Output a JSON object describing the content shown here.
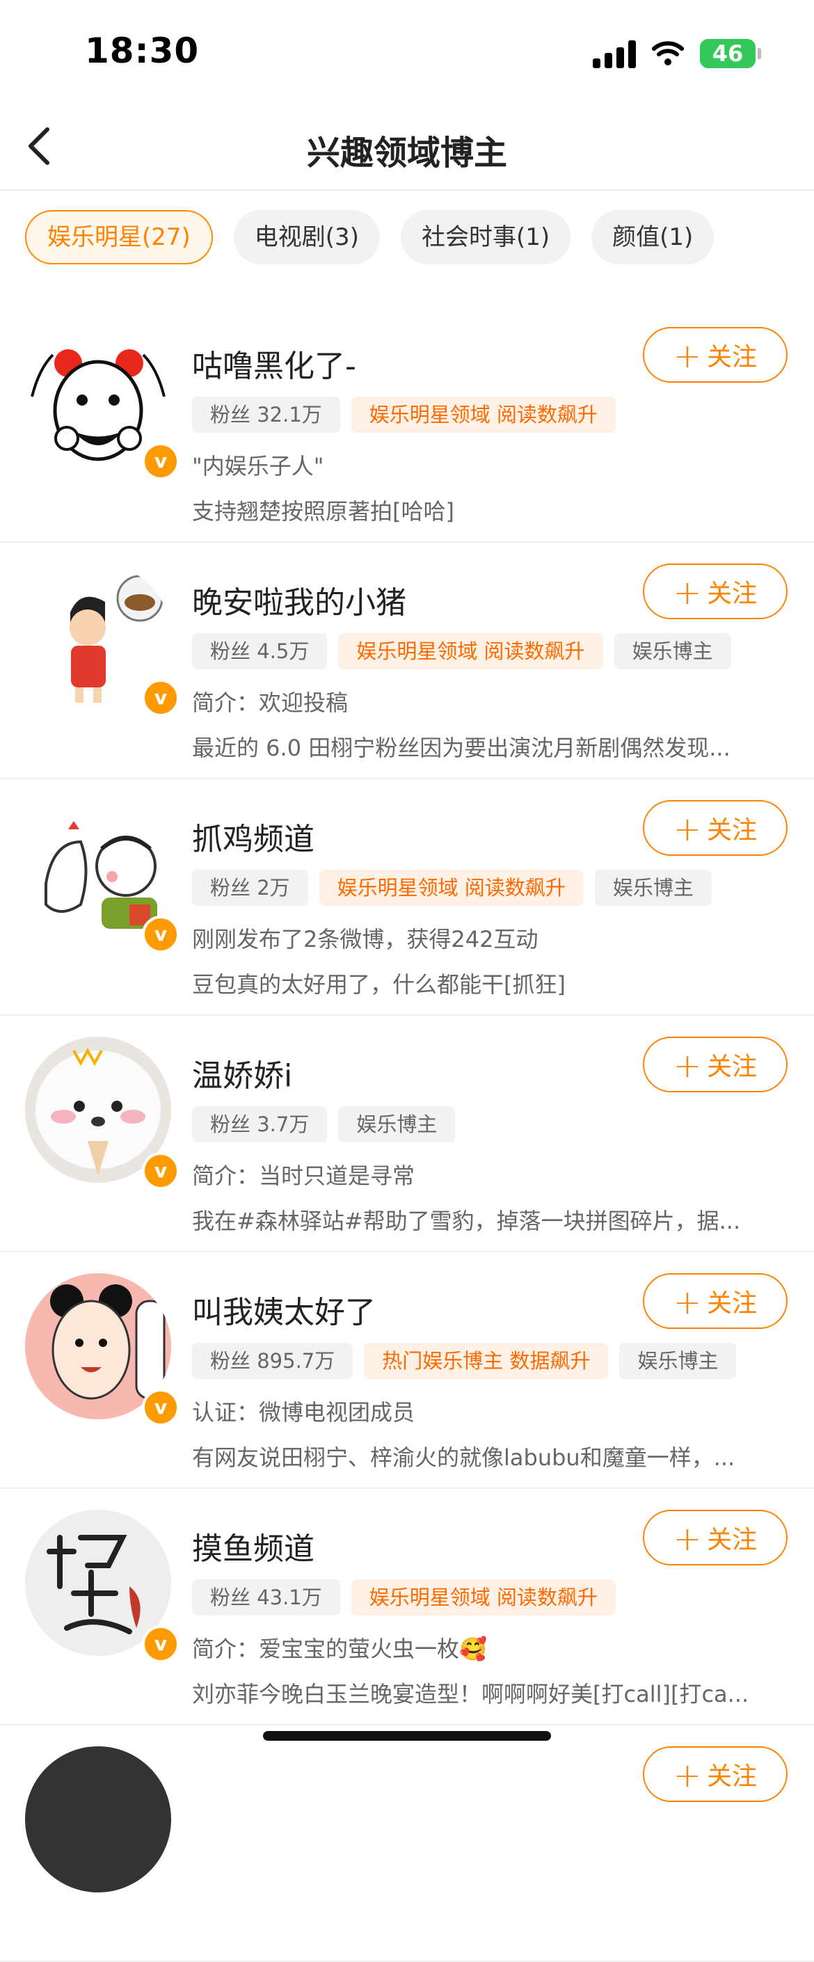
{
  "status": {
    "time": "18:30",
    "battery": "46"
  },
  "nav": {
    "title": "兴趣领域博主"
  },
  "tabs": [
    {
      "label": "娱乐明星(27)",
      "active": true
    },
    {
      "label": "电视剧(3)",
      "active": false
    },
    {
      "label": "社会时事(1)",
      "active": false
    },
    {
      "label": "颜值(1)",
      "active": false
    }
  ],
  "follow_label": "关注",
  "bloggers": [
    {
      "name": "咕噜黑化了-",
      "tags": [
        {
          "text": "粉丝 32.1万",
          "style": "gray"
        },
        {
          "text": "娱乐明星领域 阅读数飙升",
          "style": "orange"
        }
      ],
      "line1": "\"内娱乐子人\"",
      "line2": "支持翘楚按照原著拍[哈哈]"
    },
    {
      "name": "晚安啦我的小猪",
      "tags": [
        {
          "text": "粉丝 4.5万",
          "style": "gray"
        },
        {
          "text": "娱乐明星领域 阅读数飙升",
          "style": "orange"
        },
        {
          "text": "娱乐博主",
          "style": "gray"
        }
      ],
      "line1": "简介：欢迎投稿",
      "line2": "最近的 6.0 田栩宁粉丝因为要出演沈月新剧偶然发现..."
    },
    {
      "name": "抓鸡频道",
      "tags": [
        {
          "text": "粉丝 2万",
          "style": "gray"
        },
        {
          "text": "娱乐明星领域 阅读数飙升",
          "style": "orange"
        },
        {
          "text": "娱乐博主",
          "style": "gray"
        }
      ],
      "line1": "刚刚发布了2条微博，获得242互动",
      "line2": "豆包真的太好用了，什么都能干[抓狂]"
    },
    {
      "name": "温娇娇i",
      "tags": [
        {
          "text": "粉丝 3.7万",
          "style": "gray"
        },
        {
          "text": "娱乐博主",
          "style": "gray"
        }
      ],
      "line1": "简介：当时只道是寻常",
      "line2": "我在#森林驿站#帮助了雪豹，掉落一块拼图碎片，据..."
    },
    {
      "name": "叫我姨太好了",
      "tags": [
        {
          "text": "粉丝 895.7万",
          "style": "gray"
        },
        {
          "text": "热门娱乐博主 数据飙升",
          "style": "orange"
        },
        {
          "text": "娱乐博主",
          "style": "gray"
        }
      ],
      "line1": "认证：微博电视团成员",
      "line2": "有网友说田栩宁、梓渝火的就像labubu和魔童一样，..."
    },
    {
      "name": "摸鱼频道",
      "tags": [
        {
          "text": "粉丝 43.1万",
          "style": "gray"
        },
        {
          "text": "娱乐明星领域 阅读数飙升",
          "style": "orange"
        }
      ],
      "line1": "简介：爱宝宝的萤火虫一枚🥰",
      "line2": "刘亦菲今晚白玉兰晚宴造型！啊啊啊好美[打call][打ca..."
    }
  ]
}
